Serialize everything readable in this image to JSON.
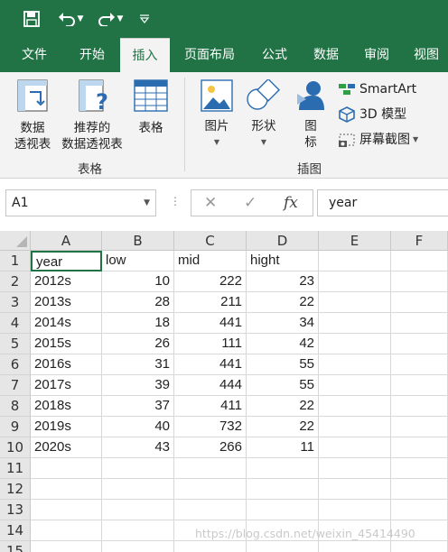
{
  "quick_access": {
    "save_icon": "save-icon",
    "undo_icon": "undo-icon",
    "redo_icon": "redo-icon",
    "customize_icon": "customize-icon"
  },
  "tabs": [
    "文件",
    "开始",
    "插入",
    "页面布局",
    "公式",
    "数据",
    "审阅",
    "视图"
  ],
  "active_tab": "插入",
  "ribbon": {
    "pivot_table": {
      "line1": "数据",
      "line2": "透视表"
    },
    "recommended_pivot": {
      "line1": "推荐的",
      "line2": "数据透视表"
    },
    "table": "表格",
    "group_tables": "表格",
    "picture": "图片",
    "shapes": "形状",
    "icons_line1": "图",
    "icons_line2": "标",
    "smartart": "SmartArt",
    "model3d": "3D 模型",
    "screenshot": "屏幕截图",
    "group_illustrations": "插图"
  },
  "formula_bar": {
    "name_box": "A1",
    "fx": "fx",
    "content": "year"
  },
  "columns": [
    "A",
    "B",
    "C",
    "D",
    "E",
    "F"
  ],
  "rows": [
    "1",
    "2",
    "3",
    "4",
    "5",
    "6",
    "7",
    "8",
    "9",
    "10",
    "11",
    "12",
    "13",
    "14",
    "15"
  ],
  "table": {
    "header": [
      "year",
      "low",
      "mid",
      "hight"
    ],
    "data": [
      [
        "2012s",
        "10",
        "222",
        "23"
      ],
      [
        "2013s",
        "28",
        "211",
        "22"
      ],
      [
        "2014s",
        "18",
        "441",
        "34"
      ],
      [
        "2015s",
        "26",
        "111",
        "42"
      ],
      [
        "2016s",
        "31",
        "441",
        "55"
      ],
      [
        "2017s",
        "39",
        "444",
        "55"
      ],
      [
        "2018s",
        "37",
        "411",
        "22"
      ],
      [
        "2019s",
        "40",
        "732",
        "22"
      ],
      [
        "2020s",
        "43",
        "266",
        "11"
      ]
    ]
  },
  "watermark": "https://blog.csdn.net/weixin_45414490",
  "colors": {
    "accent": "#217346",
    "ribbon_bg": "#f3f3f3"
  }
}
